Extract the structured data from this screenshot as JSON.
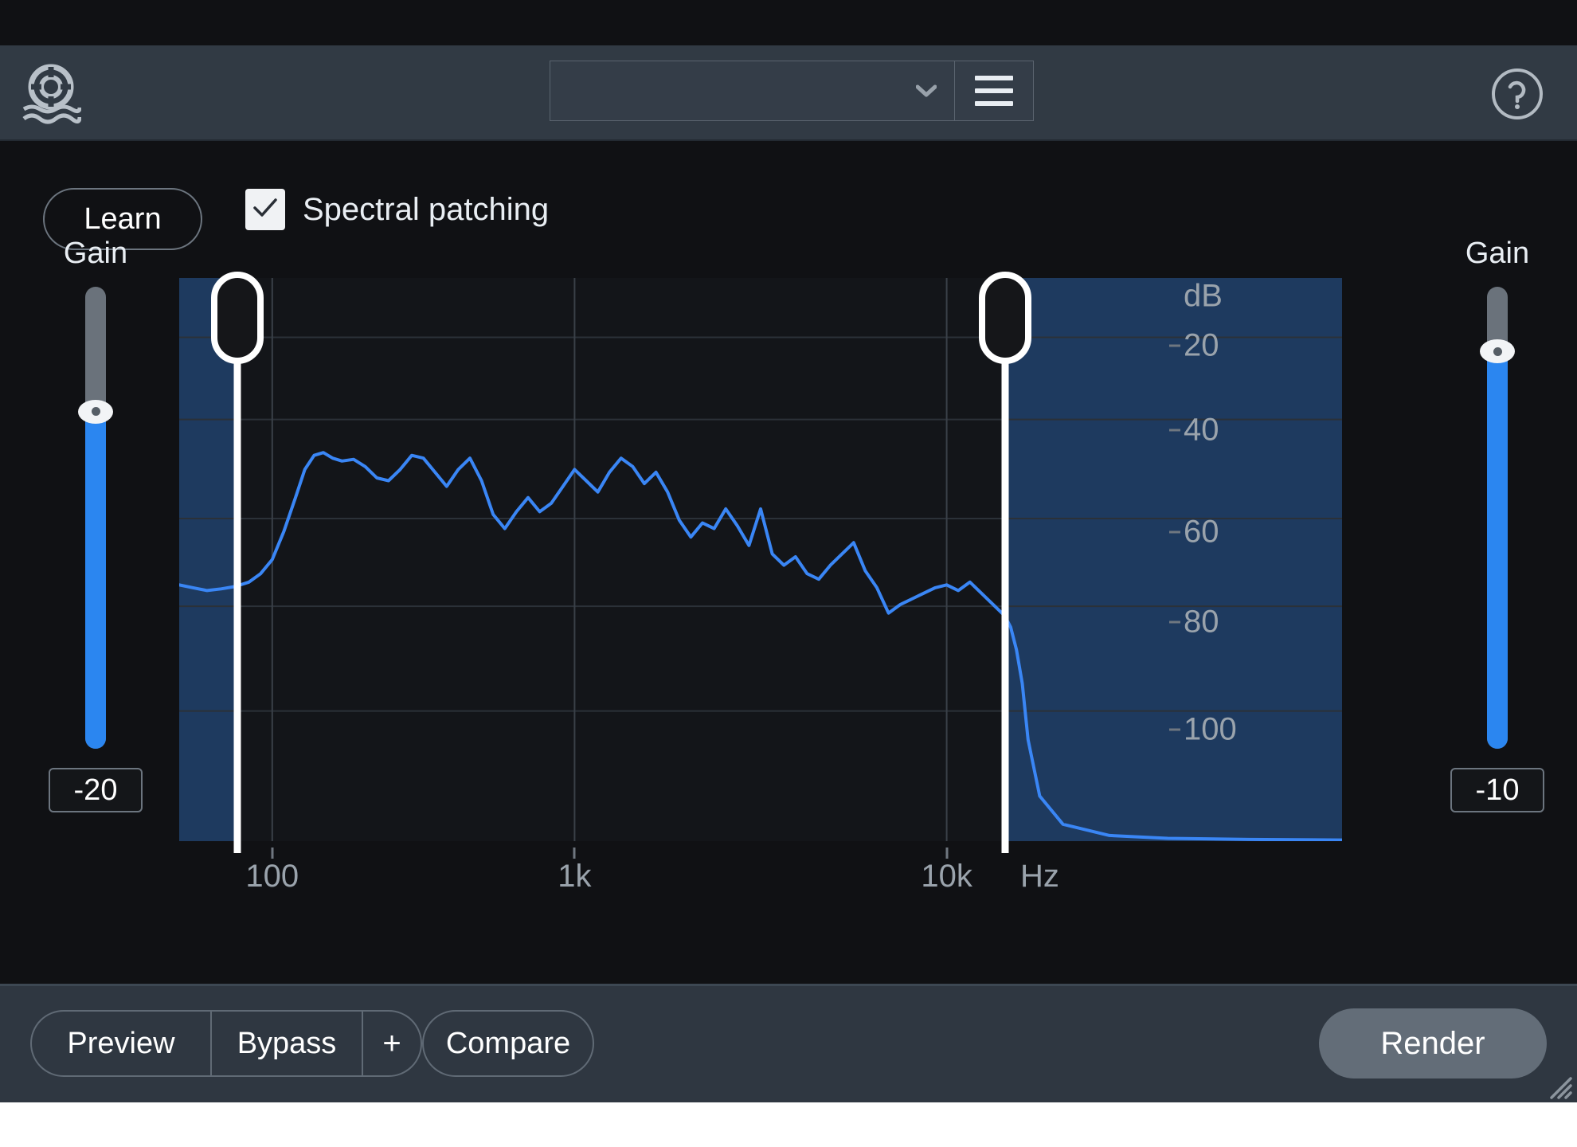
{
  "window": {
    "background_color": "#101114",
    "header_color": "#313a44",
    "footer_color": "#2f3741"
  },
  "header": {
    "logo_icon": "life-ring-waves-icon",
    "preset": {
      "value": "",
      "placeholder": "",
      "caret_icon": "chevron-down-icon"
    },
    "menu_icon": "hamburger-menu-icon",
    "help_icon": "question-mark-circle-icon"
  },
  "controls": {
    "learn_label": "Learn",
    "spectral_patching": {
      "label": "Spectral patching",
      "checked": true,
      "check_icon": "checkmark-icon"
    }
  },
  "gain_left": {
    "title": "Gain",
    "value": "-20",
    "fill_percent": 73,
    "accent_color": "#2b86f0",
    "track_color": "#6a727b"
  },
  "gain_right": {
    "title": "Gain",
    "value": "-10",
    "fill_percent": 86,
    "accent_color": "#2b86f0",
    "track_color": "#6a727b"
  },
  "chart_data": {
    "type": "line",
    "title": "",
    "xlabel": "Hz",
    "ylabel": "dB",
    "xscale": "log",
    "grid": true,
    "legend": "none",
    "xlim": [
      40,
      22000
    ],
    "ylim": [
      -110,
      -5
    ],
    "x_ticks": [
      {
        "label": "100",
        "value": 100,
        "pos_pct": 8.0
      },
      {
        "label": "1k",
        "value": 1000,
        "pos_pct": 34.0
      },
      {
        "label": "10k",
        "value": 10000,
        "pos_pct": 66.0
      },
      {
        "label": "Hz",
        "value": null,
        "pos_pct": 74.0
      }
    ],
    "y_ticks": [
      {
        "label": "dB",
        "value": null,
        "pos_pct": 4.5
      },
      {
        "label": "20",
        "value": -20,
        "pos_pct": 13.0
      },
      {
        "label": "40",
        "value": -40,
        "pos_pct": 27.5
      },
      {
        "label": "60",
        "value": -60,
        "pos_pct": 45.0
      },
      {
        "label": "80",
        "value": -80,
        "pos_pct": 60.5
      },
      {
        "label": "100",
        "value": -100,
        "pos_pct": 79.0
      }
    ],
    "series": [
      {
        "name": "Spectrum",
        "color": "#3a86f5",
        "x_pct": [
          0,
          1.2,
          2.4,
          3.6,
          4.8,
          6.0,
          7.0,
          8.0,
          9.0,
          10.0,
          10.8,
          11.6,
          12.4,
          13.2,
          14.0,
          15.0,
          16.0,
          17.0,
          18.0,
          19.0,
          20.0,
          21.0,
          22.0,
          23.0,
          24.0,
          25.0,
          26.0,
          27.0,
          28.0,
          29.0,
          30.0,
          31.0,
          32.0,
          33.0,
          34.0,
          35.0,
          36.0,
          37.0,
          38.0,
          39.0,
          40.0,
          41.0,
          42.0,
          43.0,
          44.0,
          45.0,
          46.0,
          47.0,
          48.0,
          49.0,
          50.0,
          51.0,
          52.0,
          53.0,
          54.0,
          55.0,
          56.0,
          57.0,
          58.0,
          59.0,
          60.0,
          61.0,
          62.0,
          63.0,
          64.0,
          65.0,
          66.0,
          67.0,
          68.0,
          69.0,
          70.0,
          71.0,
          71.5,
          72.0,
          72.5,
          73.0,
          74.0,
          76.0,
          80.0,
          85.0,
          92.0,
          100.0
        ],
        "y_pct": [
          54.5,
          55.0,
          55.5,
          55.2,
          54.8,
          54.0,
          52.5,
          50.0,
          45.0,
          39.0,
          34.0,
          31.5,
          31.0,
          32.0,
          32.5,
          32.2,
          33.5,
          35.5,
          36.0,
          34.0,
          31.5,
          32.0,
          34.5,
          37.0,
          34.0,
          32.0,
          36.0,
          42.0,
          44.5,
          41.5,
          39.0,
          41.5,
          40.0,
          37.0,
          34.0,
          36.0,
          38.0,
          34.5,
          32.0,
          33.5,
          36.5,
          34.5,
          38.0,
          43.0,
          46.0,
          43.5,
          44.5,
          41.0,
          44.0,
          47.5,
          41.0,
          49.0,
          51.0,
          49.5,
          52.5,
          53.5,
          51.0,
          49.0,
          47.0,
          52.0,
          55.0,
          59.5,
          58.0,
          57.0,
          56.0,
          55.0,
          54.5,
          55.5,
          54.0,
          56.0,
          58.0,
          60.0,
          62.0,
          66.0,
          72.0,
          82.0,
          92.0,
          97.0,
          99.0,
          99.5,
          99.7,
          99.8
        ]
      }
    ],
    "bands": [
      {
        "name": "low-cut-band",
        "side": "left",
        "edge_pct": 5.0,
        "label": "low cut region",
        "fill_color": "#1e3a5f"
      },
      {
        "name": "high-cut-band",
        "side": "right",
        "edge_pct": 71.0,
        "label": "high cut region",
        "fill_color": "#1e3a5f"
      }
    ]
  },
  "footer": {
    "preview_label": "Preview",
    "bypass_label": "Bypass",
    "add_label": "+",
    "compare_label": "Compare",
    "render_label": "Render",
    "resize_grip_icon": "resize-grip-icon"
  }
}
